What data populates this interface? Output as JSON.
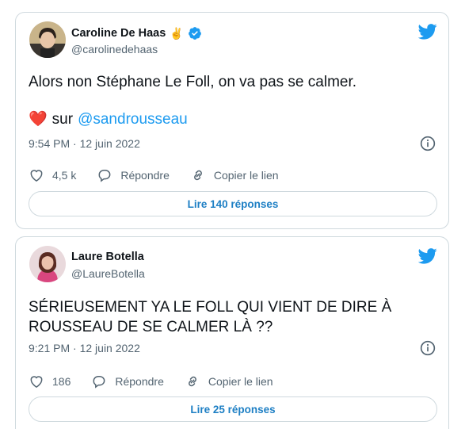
{
  "tweets": [
    {
      "name": "Caroline De Haas",
      "name_emoji": "✌️",
      "handle": "@carolinedehaas",
      "verified": true,
      "text_line1": "Alors non Stéphane Le Foll, on va pas se calmer.",
      "heart_emoji": "❤️",
      "text_line2_prefix": "sur",
      "text_line2_mention": "@sandrousseau",
      "time": "9:54 PM · 12 juin 2022",
      "likes": "4,5 k",
      "reply_label": "Répondre",
      "copy_label": "Copier le lien",
      "read_replies": "Lire 140 réponses"
    },
    {
      "name": "Laure Botella",
      "handle": "@LaureBotella",
      "verified": false,
      "text_line1": "SÉRIEUSEMENT YA LE FOLL QUI VIENT DE DIRE À",
      "text_line2": "ROUSSEAU DE SE CALMER LÀ ??",
      "time": "9:21 PM · 12 juin 2022",
      "likes": "186",
      "reply_label": "Répondre",
      "copy_label": "Copier le lien",
      "read_replies": "Lire 25 réponses"
    }
  ],
  "colors": {
    "accent": "#1d9bf0",
    "muted": "#536471",
    "border": "#cfd9de",
    "heart": "#e0245e"
  },
  "icons": [
    "twitter-bird-icon",
    "verified-badge-icon",
    "info-icon",
    "heart-icon",
    "reply-icon",
    "link-icon"
  ]
}
